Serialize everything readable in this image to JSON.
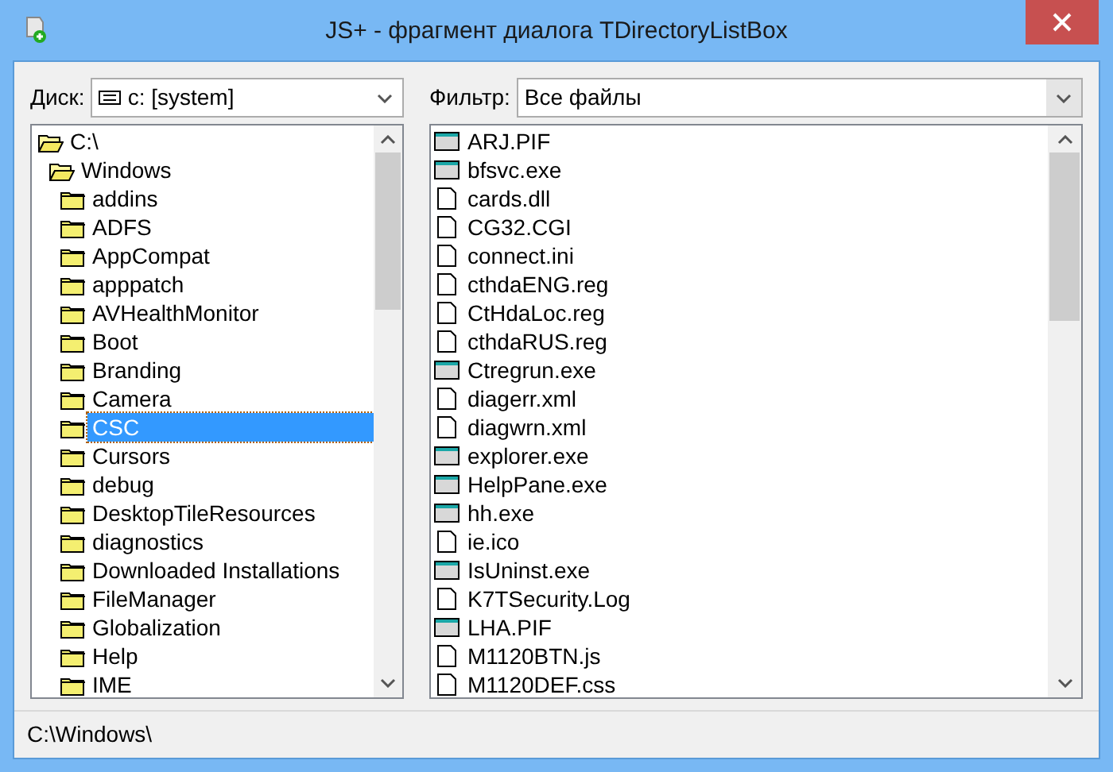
{
  "window": {
    "title": "JS+ - фрагмент диалога TDirectoryListBox"
  },
  "drive": {
    "label": "Диск:",
    "value": "c: [system]"
  },
  "filter": {
    "label": "Фильтр:",
    "value": "Все файлы"
  },
  "directory_tree": [
    {
      "name": "C:\\",
      "expanded": true,
      "selected": false,
      "children": [
        {
          "name": "Windows",
          "expanded": true,
          "selected": false,
          "children": [
            {
              "name": "addins",
              "expanded": false,
              "selected": false
            },
            {
              "name": "ADFS",
              "expanded": false,
              "selected": false
            },
            {
              "name": "AppCompat",
              "expanded": false,
              "selected": false
            },
            {
              "name": "apppatch",
              "expanded": false,
              "selected": false
            },
            {
              "name": "AVHealthMonitor",
              "expanded": false,
              "selected": false
            },
            {
              "name": "Boot",
              "expanded": false,
              "selected": false
            },
            {
              "name": "Branding",
              "expanded": false,
              "selected": false
            },
            {
              "name": "Camera",
              "expanded": false,
              "selected": false
            },
            {
              "name": "CSC",
              "expanded": false,
              "selected": true
            },
            {
              "name": "Cursors",
              "expanded": false,
              "selected": false
            },
            {
              "name": "debug",
              "expanded": false,
              "selected": false
            },
            {
              "name": "DesktopTileResources",
              "expanded": false,
              "selected": false
            },
            {
              "name": "diagnostics",
              "expanded": false,
              "selected": false
            },
            {
              "name": "Downloaded Installations",
              "expanded": false,
              "selected": false
            },
            {
              "name": "FileManager",
              "expanded": false,
              "selected": false
            },
            {
              "name": "Globalization",
              "expanded": false,
              "selected": false
            },
            {
              "name": "Help",
              "expanded": false,
              "selected": false
            },
            {
              "name": "IME",
              "expanded": false,
              "selected": false
            }
          ]
        }
      ]
    }
  ],
  "files": [
    {
      "name": "ARJ.PIF",
      "kind": "program"
    },
    {
      "name": "bfsvc.exe",
      "kind": "program"
    },
    {
      "name": "cards.dll",
      "kind": "document"
    },
    {
      "name": "CG32.CGI",
      "kind": "document"
    },
    {
      "name": "connect.ini",
      "kind": "document"
    },
    {
      "name": "cthdaENG.reg",
      "kind": "document"
    },
    {
      "name": "CtHdaLoc.reg",
      "kind": "document"
    },
    {
      "name": "cthdaRUS.reg",
      "kind": "document"
    },
    {
      "name": "Ctregrun.exe",
      "kind": "program"
    },
    {
      "name": "diagerr.xml",
      "kind": "document"
    },
    {
      "name": "diagwrn.xml",
      "kind": "document"
    },
    {
      "name": "explorer.exe",
      "kind": "program"
    },
    {
      "name": "HelpPane.exe",
      "kind": "program"
    },
    {
      "name": "hh.exe",
      "kind": "program"
    },
    {
      "name": "ie.ico",
      "kind": "document"
    },
    {
      "name": "IsUninst.exe",
      "kind": "program"
    },
    {
      "name": "K7TSecurity.Log",
      "kind": "document"
    },
    {
      "name": "LHA.PIF",
      "kind": "program"
    },
    {
      "name": "M1120BTN.js",
      "kind": "document"
    },
    {
      "name": "M1120DEF.css",
      "kind": "document"
    }
  ],
  "status_bar": {
    "text": "C:\\Windows\\"
  }
}
